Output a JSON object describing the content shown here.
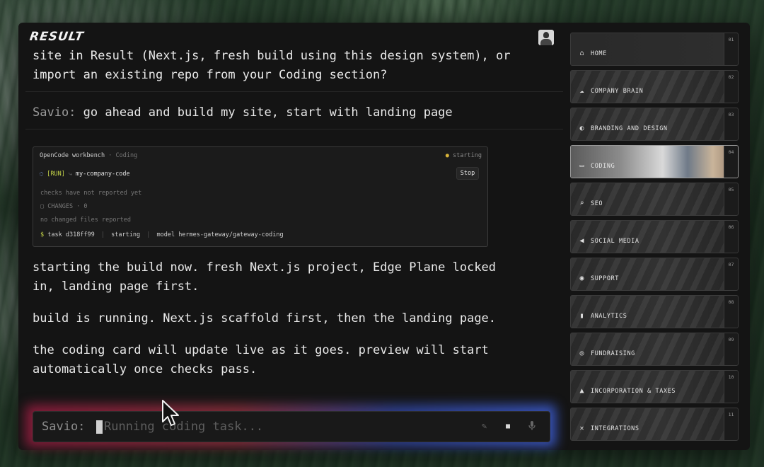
{
  "brand": {
    "logo_text": "RESULT"
  },
  "chat": {
    "messages": [
      {
        "id": "m1",
        "text_line1": "site in Result (Next.js, fresh build using this design system), or",
        "text_line2": "import an existing repo from your Coding section?"
      },
      {
        "id": "m2",
        "who": "Savio:",
        "text": "go ahead and build my site, start with landing page"
      },
      {
        "id": "m3",
        "text_line1": "starting the build now. fresh Next.js project, Edge Plane locked",
        "text_line2": "in, landing page first."
      },
      {
        "id": "m4",
        "text": "build is running. Next.js scaffold first, then the landing page."
      },
      {
        "id": "m5",
        "text_line1": "the coding card will update live as it goes. preview will start",
        "text_line2": "automatically once checks pass."
      }
    ]
  },
  "coding_card": {
    "title": "OpenCode workbench",
    "subtitle": "· Coding",
    "status_dot": "●",
    "status": "starting",
    "run_spinner": "◌",
    "run_tag": "[RUN]",
    "run_prefix": "⤷",
    "repo": "my-company-code",
    "stop_label": "Stop",
    "checks_text": "checks have not reported yet",
    "changes_label": "▢ CHANGES · 0",
    "changes_text": "no changed files reported",
    "task_dollar": "$",
    "task_id": "task d318ff99",
    "task_state": "starting",
    "task_model": "model hermes-gateway/gateway-coding",
    "separator": "|"
  },
  "composer": {
    "who": "Savio:",
    "placeholder": "Running coding task...",
    "value": ""
  },
  "sidebar": {
    "items": [
      {
        "num": "01",
        "label": "HOME",
        "icon": "⌂"
      },
      {
        "num": "02",
        "label": "COMPANY BRAIN",
        "icon": "☁"
      },
      {
        "num": "03",
        "label": "BRANDING AND DESIGN",
        "icon": "◐"
      },
      {
        "num": "04",
        "label": "CODING",
        "icon": "▭"
      },
      {
        "num": "05",
        "label": "SEO",
        "icon": "⌕"
      },
      {
        "num": "06",
        "label": "SOCIAL MEDIA",
        "icon": "◀"
      },
      {
        "num": "07",
        "label": "SUPPORT",
        "icon": "◉"
      },
      {
        "num": "08",
        "label": "ANALYTICS",
        "icon": "▮"
      },
      {
        "num": "09",
        "label": "FUNDRAISING",
        "icon": "◎"
      },
      {
        "num": "10",
        "label": "INCORPORATION & TAXES",
        "icon": "▲"
      },
      {
        "num": "11",
        "label": "INTEGRATIONS",
        "icon": "✕"
      }
    ]
  }
}
